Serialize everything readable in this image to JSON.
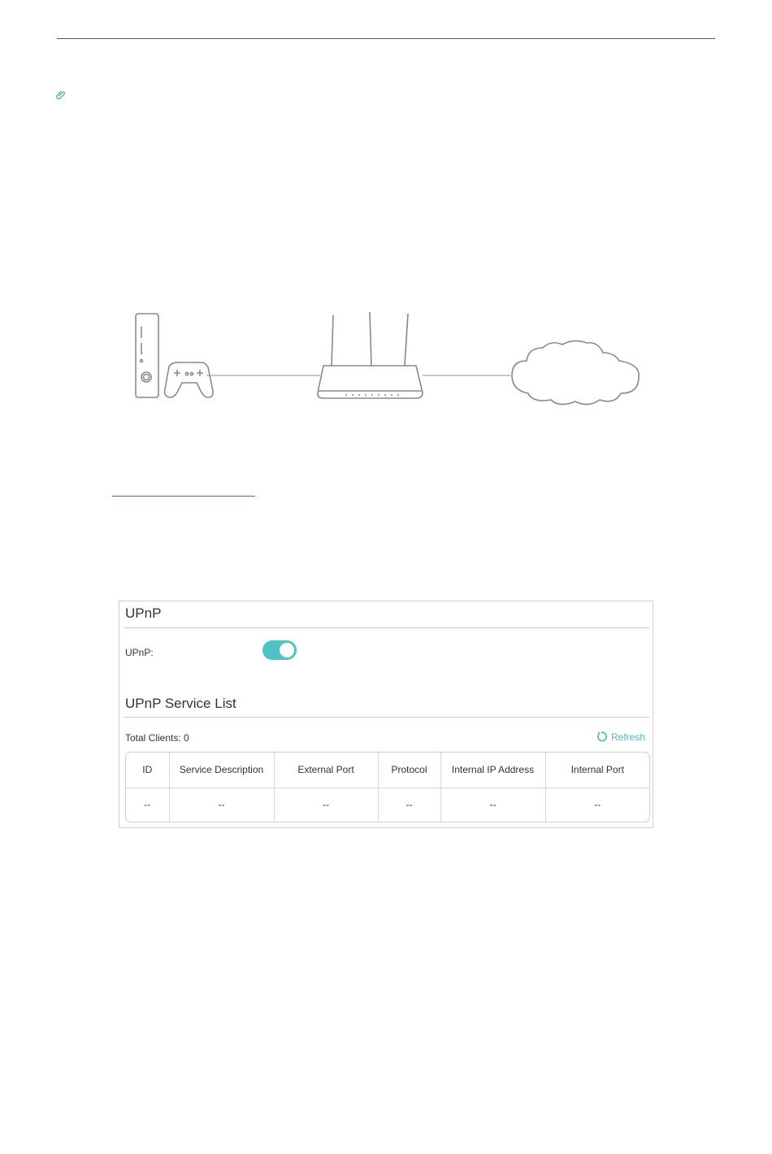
{
  "panel": {
    "upnp_title": "UPnP",
    "upnp_label": "UPnP:",
    "upnp_enabled": true,
    "service_list_title": "UPnP Service List",
    "total_clients_label": "Total Clients: 0",
    "refresh_label": "Refresh",
    "table": {
      "columns": [
        "ID",
        "Service Description",
        "External Port",
        "Protocol",
        "Internal IP Address",
        "Internal Port"
      ],
      "rows": [
        [
          "--",
          "--",
          "--",
          "--",
          "--",
          "--"
        ]
      ]
    }
  },
  "colors": {
    "accent": "#4fc3c3",
    "link": "#4fb9c7",
    "border": "#cfcfcf"
  },
  "icons": {
    "note": "paperclip-icon",
    "refresh": "refresh-icon",
    "console": "game-console-icon",
    "controller": "gamepad-icon",
    "router": "router-icon",
    "internet": "cloud-icon"
  }
}
